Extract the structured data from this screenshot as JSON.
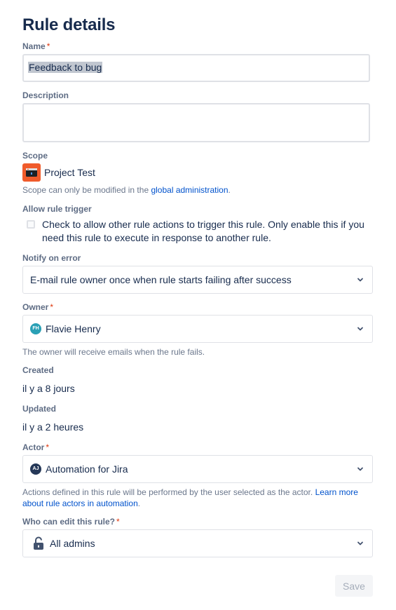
{
  "title": "Rule details",
  "name": {
    "label": "Name",
    "required": "*",
    "value": "Feedback to bug"
  },
  "description": {
    "label": "Description",
    "value": ""
  },
  "scope": {
    "label": "Scope",
    "project": "Project Test",
    "help_prefix": "Scope can only be modified in the ",
    "help_link": "global administration",
    "help_suffix": "."
  },
  "allow_trigger": {
    "label": "Allow rule trigger",
    "checkbox_text": "Check to allow other rule actions to trigger this rule. Only enable this if you need this rule to execute in response to another rule.",
    "checked": false
  },
  "notify": {
    "label": "Notify on error",
    "value": "E-mail rule owner once when rule starts failing after success"
  },
  "owner": {
    "label": "Owner",
    "required": "*",
    "avatar_initials": "FH",
    "value": "Flavie Henry",
    "help": "The owner will receive emails when the rule fails."
  },
  "created": {
    "label": "Created",
    "value": "il y a 8 jours"
  },
  "updated": {
    "label": "Updated",
    "value": "il y a 2 heures"
  },
  "actor": {
    "label": "Actor",
    "required": "*",
    "avatar_initials": "AJ",
    "value": "Automation for Jira",
    "help_prefix": "Actions defined in this rule will be performed by the user selected as the actor. ",
    "help_link": "Learn more about rule actors in automation",
    "help_suffix": "."
  },
  "editors": {
    "label": "Who can edit this rule?",
    "required": "*",
    "value": "All admins"
  },
  "save_label": "Save",
  "colors": {
    "accent": "#0052cc",
    "required": "#de350b",
    "scope_icon": "#f05b2b"
  }
}
